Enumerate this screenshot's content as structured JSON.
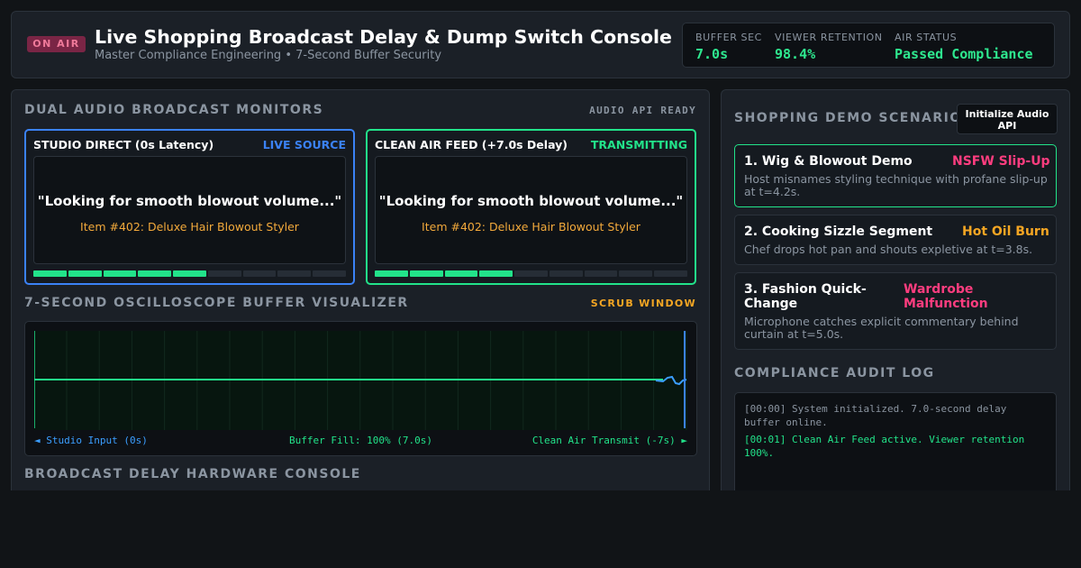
{
  "header": {
    "badge": "ON AIR",
    "title": "Live Shopping Broadcast Delay & Dump Switch Console",
    "subtitle": "Master Compliance Engineering • 7-Second Buffer Security",
    "stats": [
      {
        "label": "BUFFER SEC",
        "value": "7.0s"
      },
      {
        "label": "VIEWER RETENTION",
        "value": "98.4%"
      },
      {
        "label": "AIR STATUS",
        "value": "Passed Compliance"
      }
    ]
  },
  "monitors": {
    "title": "DUAL AUDIO BROADCAST MONITORS",
    "api_status": "AUDIO API READY",
    "studio": {
      "title": "STUDIO DIRECT (0s Latency)",
      "status": "LIVE SOURCE",
      "quote": "\"Looking for smooth blowout volume...\"",
      "item": "Item #402: Deluxe Hair Blowout Styler",
      "level": 0.5
    },
    "air": {
      "title": "CLEAN AIR FEED (+7.0s Delay)",
      "status": "TRANSMITTING",
      "quote": "\"Looking for smooth blowout volume...\"",
      "item": "Item #402: Deluxe Hair Blowout Styler",
      "level": 0.4
    }
  },
  "scope": {
    "title": "7-SECOND OSCILLOSCOPE BUFFER VISUALIZER",
    "tag": "SCRUB WINDOW",
    "left_label": "◄ Studio Input (0s)",
    "center_label": "Buffer Fill: 100% (7.0s)",
    "right_label": "Clean Air Transmit (-7s) ►"
  },
  "console": {
    "title": "BROADCAST DELAY HARDWARE CONSOLE"
  },
  "scenarios": {
    "title": "SHOPPING DEMO SCENARIOS",
    "init_button": "Initialize Audio API",
    "items": [
      {
        "name": "1. Wig & Blowout Demo",
        "tag": "NSFW Slip-Up",
        "desc": "Host misnames styling technique with profane slip-up at t=4.2s.",
        "tag_color": "#ff3d7f",
        "active": true
      },
      {
        "name": "2. Cooking Sizzle Segment",
        "tag": "Hot Oil Burn",
        "desc": "Chef drops hot pan and shouts expletive at t=3.8s.",
        "tag_color": "#f5a623",
        "active": false
      },
      {
        "name": "3. Fashion Quick-Change",
        "tag": "Wardrobe Malfunction",
        "desc": "Microphone catches explicit commentary behind curtain at t=5.0s.",
        "tag_color": "#ff3d7f",
        "active": false
      }
    ]
  },
  "audit": {
    "title": "COMPLIANCE AUDIT LOG",
    "entries": [
      {
        "text": "[00:00] System initialized. 7.0-second delay buffer online.",
        "color": "#8b95a1"
      },
      {
        "text": "[00:01] Clean Air Feed active. Viewer retention 100%.",
        "color": "#22e38a"
      }
    ]
  },
  "colors": {
    "accent_green": "#22e38a",
    "accent_blue": "#3b82f6",
    "accent_amber": "#f5a623",
    "accent_pink": "#ff3d7f"
  }
}
